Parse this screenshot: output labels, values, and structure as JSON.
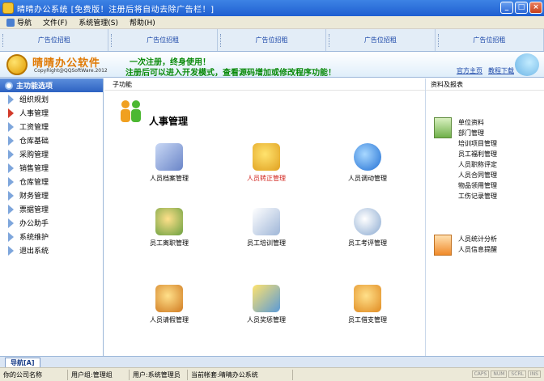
{
  "window": {
    "title": "晴晴办公系统 [免费版！注册后将自动去除广告栏！]"
  },
  "menu": {
    "items": [
      {
        "label": "导航"
      },
      {
        "label": "文件(F)"
      },
      {
        "label": "系统管理(S)"
      },
      {
        "label": "帮助(H)"
      }
    ]
  },
  "adbar": {
    "cells": [
      "广告位招租",
      "广告位招租",
      "广告位招租",
      "广告位招租",
      "广告位招租"
    ]
  },
  "banner": {
    "logo_title": "晴晴办公软件",
    "logo_sub": "CopyRight@QQSoftWare.2012",
    "line1": "一次注册，终身使用！",
    "line2": "注册后可以进入开发模式，查看源码增加或修改程序功能！",
    "link_home": "官方主页",
    "link_download": "教程下载"
  },
  "sidebar": {
    "header": "主功能选项",
    "items": [
      {
        "label": "组织规划",
        "active": false
      },
      {
        "label": "人事管理",
        "active": true
      },
      {
        "label": "工资管理",
        "active": false
      },
      {
        "label": "仓库基础",
        "active": false
      },
      {
        "label": "采购管理",
        "active": false
      },
      {
        "label": "销售管理",
        "active": false
      },
      {
        "label": "仓库管理",
        "active": false
      },
      {
        "label": "财务管理",
        "active": false
      },
      {
        "label": "票据管理",
        "active": false
      },
      {
        "label": "办公助手",
        "active": false
      },
      {
        "label": "系统维护",
        "active": false
      },
      {
        "label": "退出系统",
        "active": false
      }
    ]
  },
  "content": {
    "header": "子功能",
    "module_title": "人事管理",
    "functions": [
      {
        "label": "人员档案管理",
        "icon": "personnel-file-icon",
        "highlight": false
      },
      {
        "label": "人员转正管理",
        "icon": "regularization-icon",
        "highlight": true
      },
      {
        "label": "人员调动管理",
        "icon": "transfer-icon",
        "highlight": false
      },
      {
        "label": "员工离职管理",
        "icon": "resignation-icon",
        "highlight": false
      },
      {
        "label": "员工培训管理",
        "icon": "training-icon",
        "highlight": false
      },
      {
        "label": "员工考评管理",
        "icon": "evaluation-icon",
        "highlight": false
      },
      {
        "label": "人员请假管理",
        "icon": "leave-icon",
        "highlight": false
      },
      {
        "label": "人员奖惩管理",
        "icon": "reward-icon",
        "highlight": false
      },
      {
        "label": "员工借支管理",
        "icon": "advance-icon",
        "highlight": false
      }
    ]
  },
  "rightpanel": {
    "header": "资料及报表",
    "group1": [
      "单位资料",
      "部门管理",
      "培训项目管理",
      "员工福利管理",
      "人员职称评定",
      "人员合同管理",
      "物品领用管理",
      "工伤记录管理"
    ],
    "group2": [
      "人员统计分析",
      "人员信息提醒"
    ]
  },
  "tabbar": {
    "tab": "导航[A]"
  },
  "statusbar": {
    "company": "你的公司名称",
    "group": "用户组:管理组",
    "user": "用户:系统管理员",
    "account": "当前帐套:晴晴办公系统",
    "indicators": [
      "CAPS",
      "NUM",
      "SCRL",
      "INS"
    ]
  },
  "colors": {
    "accent": "#2d62c2",
    "banner_text": "#0a8a0a",
    "highlight_text": "#d0201a"
  }
}
